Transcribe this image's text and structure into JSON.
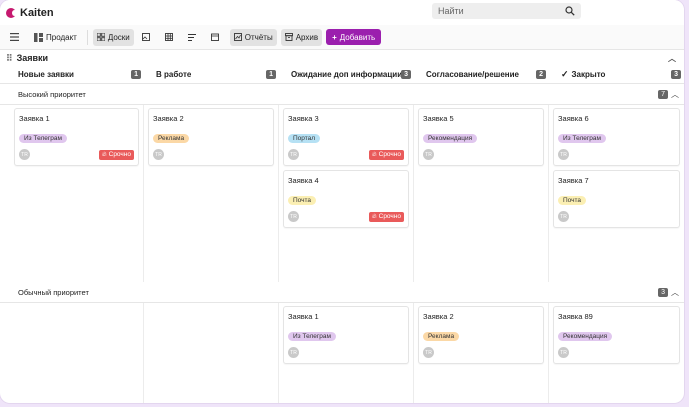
{
  "app": {
    "name": "Kaiten"
  },
  "search": {
    "placeholder": "Найти"
  },
  "toolbar": {
    "space": "Продакт",
    "boards": "Доски",
    "reports": "Отчёты",
    "archive": "Архив",
    "add": "Добавить"
  },
  "board": {
    "title": "Заявки"
  },
  "columns": [
    {
      "title": "Новые заявки",
      "count": "1"
    },
    {
      "title": "В работе",
      "count": "1"
    },
    {
      "title": "Ожидание доп информации",
      "count": "3"
    },
    {
      "title": "Согласование/решение",
      "count": "2"
    },
    {
      "title": "Закрыто",
      "count": "3"
    }
  ],
  "lanes": [
    {
      "title": "Высокий приоритет",
      "count": "7",
      "cols": [
        [
          {
            "title": "Заявка 1",
            "tag": "Из Телеграм",
            "tag_color": "purple",
            "avatar": "TR",
            "urgent": "Срочно"
          }
        ],
        [
          {
            "title": "Заявка 2",
            "tag": "Реклама",
            "tag_color": "orange",
            "avatar": "TR"
          }
        ],
        [
          {
            "title": "Заявка 3",
            "tag": "Портал",
            "tag_color": "blue",
            "avatar": "TR",
            "urgent": "Срочно"
          },
          {
            "title": "Заявка 4",
            "tag": "Почта",
            "tag_color": "yellow",
            "avatar": "TR",
            "urgent": "Срочно"
          }
        ],
        [
          {
            "title": "Заявка 5",
            "tag": "Рекомендация",
            "tag_color": "purple",
            "avatar": "TR"
          }
        ],
        [
          {
            "title": "Заявка 6",
            "tag": "Из Телеграм",
            "tag_color": "purple",
            "avatar": "TR"
          },
          {
            "title": "Заявка 7",
            "tag": "Почта",
            "tag_color": "yellow",
            "avatar": "TR"
          }
        ]
      ]
    },
    {
      "title": "Обычный приоритет",
      "count": "3",
      "cols": [
        [],
        [],
        [
          {
            "title": "Заявка 1",
            "tag": "Из Телеграм",
            "tag_color": "purple",
            "avatar": "TR"
          }
        ],
        [
          {
            "title": "Заявка 2",
            "tag": "Реклама",
            "tag_color": "orange",
            "avatar": "TR"
          }
        ],
        [
          {
            "title": "Заявка 89",
            "tag": "Рекомендация",
            "tag_color": "purple",
            "avatar": "TR"
          }
        ]
      ]
    }
  ]
}
